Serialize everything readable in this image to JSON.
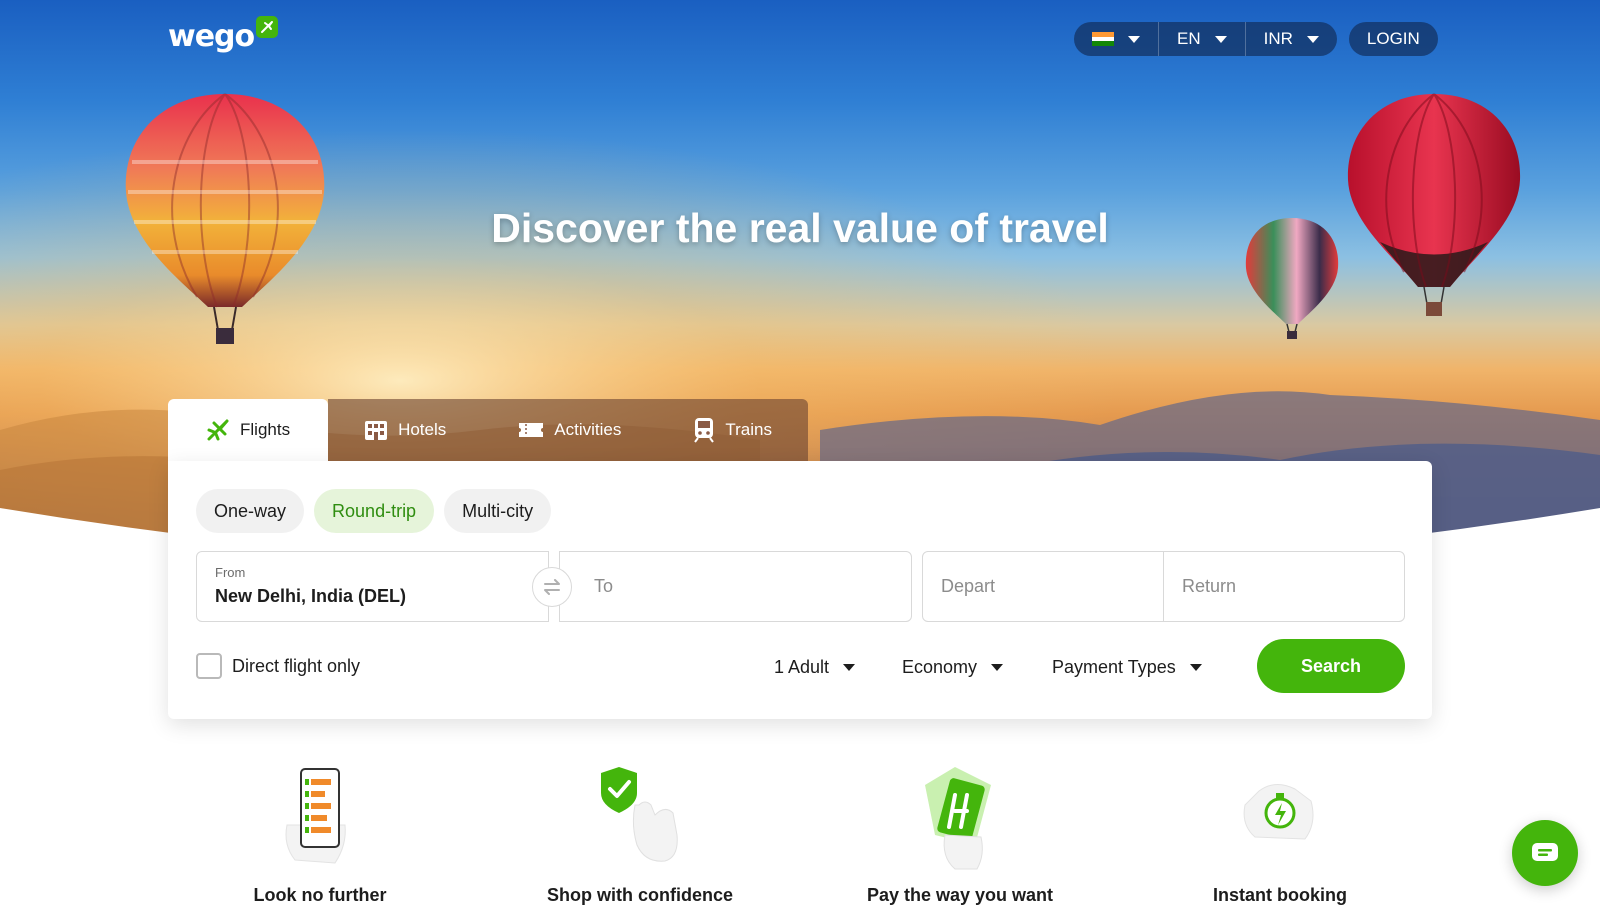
{
  "header": {
    "logo_text": "wego",
    "country_flag": "India",
    "language": "EN",
    "currency": "INR",
    "login_label": "LOGIN"
  },
  "hero": {
    "title": "Discover the real value of travel"
  },
  "tabs": [
    {
      "label": "Flights",
      "icon": "plane-icon",
      "active": true
    },
    {
      "label": "Hotels",
      "icon": "hotel-icon",
      "active": false
    },
    {
      "label": "Activities",
      "icon": "ticket-icon",
      "active": false
    },
    {
      "label": "Trains",
      "icon": "train-icon",
      "active": false
    }
  ],
  "search": {
    "trip_types": [
      {
        "label": "One-way",
        "selected": false
      },
      {
        "label": "Round-trip",
        "selected": true
      },
      {
        "label": "Multi-city",
        "selected": false
      }
    ],
    "from_label": "From",
    "from_value": "New Delhi, India (DEL)",
    "to_placeholder": "To",
    "depart_placeholder": "Depart",
    "return_placeholder": "Return",
    "direct_only_label": "Direct flight only",
    "direct_only_checked": false,
    "passengers": "1 Adult",
    "cabin_class": "Economy",
    "payment_types": "Payment Types",
    "search_label": "Search"
  },
  "features": [
    {
      "label": "Look no further",
      "icon": "phone-list-icon"
    },
    {
      "label": "Shop with confidence",
      "icon": "shield-check-icon"
    },
    {
      "label": "Pay the way you want",
      "icon": "payment-cards-icon"
    },
    {
      "label": "Instant booking",
      "icon": "stopwatch-icon"
    }
  ],
  "colors": {
    "brand_green": "#44b50c",
    "selected_trip_bg": "#e6f4da",
    "selected_trip_text": "#2f8d10"
  }
}
